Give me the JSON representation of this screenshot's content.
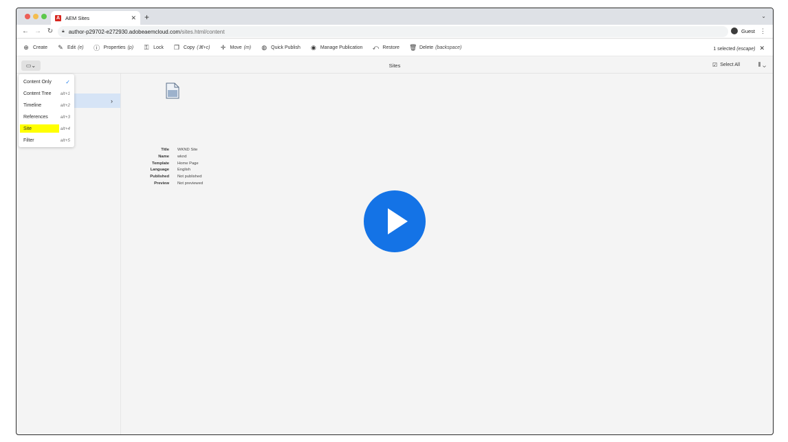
{
  "browser": {
    "tab_title": "AEM Sites",
    "favicon_text": "A",
    "url_host": "author-p29702-e272930.adobeaemcloud.com",
    "url_path": "/sites.html/content",
    "profile_label": "Guest"
  },
  "actionbar": {
    "items": [
      {
        "icon": "plus-circle-icon",
        "label": "Create",
        "shortcut": ""
      },
      {
        "icon": "pencil-icon",
        "label": "Edit",
        "shortcut": "(e)"
      },
      {
        "icon": "info-icon",
        "label": "Properties",
        "shortcut": "(p)"
      },
      {
        "icon": "lock-icon",
        "label": "Lock",
        "shortcut": ""
      },
      {
        "icon": "copy-icon",
        "label": "Copy",
        "shortcut": "(⌘+c)"
      },
      {
        "icon": "move-icon",
        "label": "Move",
        "shortcut": "(m)"
      },
      {
        "icon": "globe-icon",
        "label": "Quick Publish",
        "shortcut": ""
      },
      {
        "icon": "globe-gear-icon",
        "label": "Manage Publication",
        "shortcut": ""
      },
      {
        "icon": "restore-icon",
        "label": "Restore",
        "shortcut": ""
      },
      {
        "icon": "trash-icon",
        "label": "Delete",
        "shortcut": "(backspace)"
      }
    ],
    "selected_count": "1 selected",
    "selected_shortcut": "(escape)"
  },
  "header": {
    "title": "Sites",
    "select_all": "Select All"
  },
  "rail_menu": {
    "items": [
      {
        "label": "Content Only",
        "shortcut": "",
        "checked": true,
        "highlighted": false
      },
      {
        "label": "Content Tree",
        "shortcut": "alt+1",
        "checked": false,
        "highlighted": false
      },
      {
        "label": "Timeline",
        "shortcut": "alt+2",
        "checked": false,
        "highlighted": false
      },
      {
        "label": "References",
        "shortcut": "alt+3",
        "checked": false,
        "highlighted": false
      },
      {
        "label": "Site",
        "shortcut": "alt+4",
        "checked": false,
        "highlighted": true
      },
      {
        "label": "Filter",
        "shortcut": "alt+5",
        "checked": false,
        "highlighted": false
      }
    ],
    "highlight_color": "#ffff00"
  },
  "details": {
    "rows": [
      {
        "key": "Title",
        "value": "WKND Site"
      },
      {
        "key": "Name",
        "value": "wknd"
      },
      {
        "key": "Template",
        "value": "Home Page"
      },
      {
        "key": "Language",
        "value": "English"
      },
      {
        "key": "Published",
        "value": "Not published"
      },
      {
        "key": "Preview",
        "value": "Not previewed"
      }
    ]
  },
  "colors": {
    "accent": "#1473e6",
    "selection": "#d6e4f6"
  }
}
